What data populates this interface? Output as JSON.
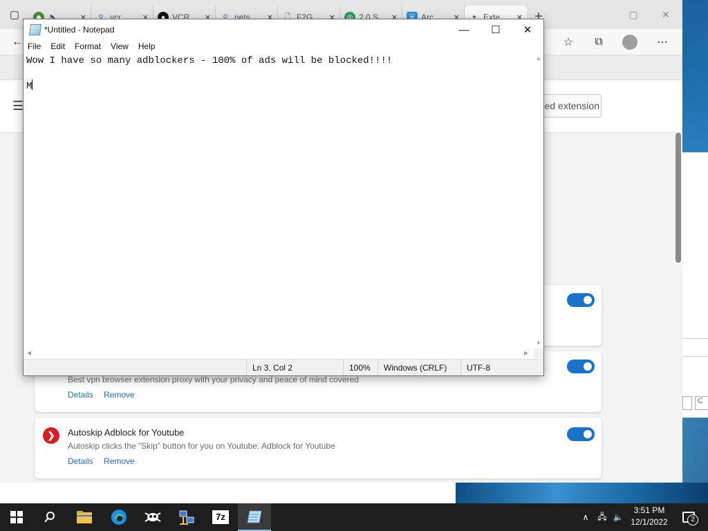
{
  "browser": {
    "tabs": [
      {
        "label": "",
        "icon": "browser-tab-icon"
      },
      {
        "label": "vcr",
        "icon": "search-icon"
      },
      {
        "label": "VCR",
        "icon": "app-icon"
      },
      {
        "label": "nets",
        "icon": "search-icon"
      },
      {
        "label": "F2G",
        "icon": "document-icon"
      },
      {
        "label": "2.0 S",
        "icon": "globe-icon"
      },
      {
        "label": "Arc",
        "icon": "shield-icon"
      },
      {
        "label": "Exte",
        "icon": "puzzle-icon"
      }
    ],
    "load_unpacked_label": "lled extension",
    "extensions": [
      {
        "name": "",
        "description": "Best vpn browser extension proxy with your privacy and peace of mind covered",
        "details": "Details",
        "remove": "Remove",
        "enabled": true
      },
      {
        "name": "Autoskip Adblock for Youtube",
        "description": "Autoskip clicks the \"Skip\" button for you on Youtube. Adblock for Youtube",
        "details": "Details",
        "remove": "Remove",
        "enabled": true
      }
    ]
  },
  "notepad": {
    "title": "*Untitled - Notepad",
    "menu": [
      "File",
      "Edit",
      "Format",
      "View",
      "Help"
    ],
    "lines": [
      "Wow I have so many adblockers - 100% of ads will be blocked!!!!",
      "",
      "M"
    ],
    "status": {
      "position": "Ln 3, Col 2",
      "zoom": "100%",
      "line_ending": "Windows (CRLF)",
      "encoding": "UTF-8"
    }
  },
  "taskbar": {
    "apps": [
      "start",
      "search",
      "file-explorer",
      "edge",
      "app-2",
      "network-app",
      "7zip",
      "notepad"
    ],
    "app_7z_label": "7z",
    "clock_time": "3:51 PM",
    "clock_date": "12/1/2022",
    "notification_count": "2"
  },
  "colors": {
    "accent": "#1a73c8",
    "link": "#1b6dbf",
    "taskbar": "#1e1e1e"
  }
}
